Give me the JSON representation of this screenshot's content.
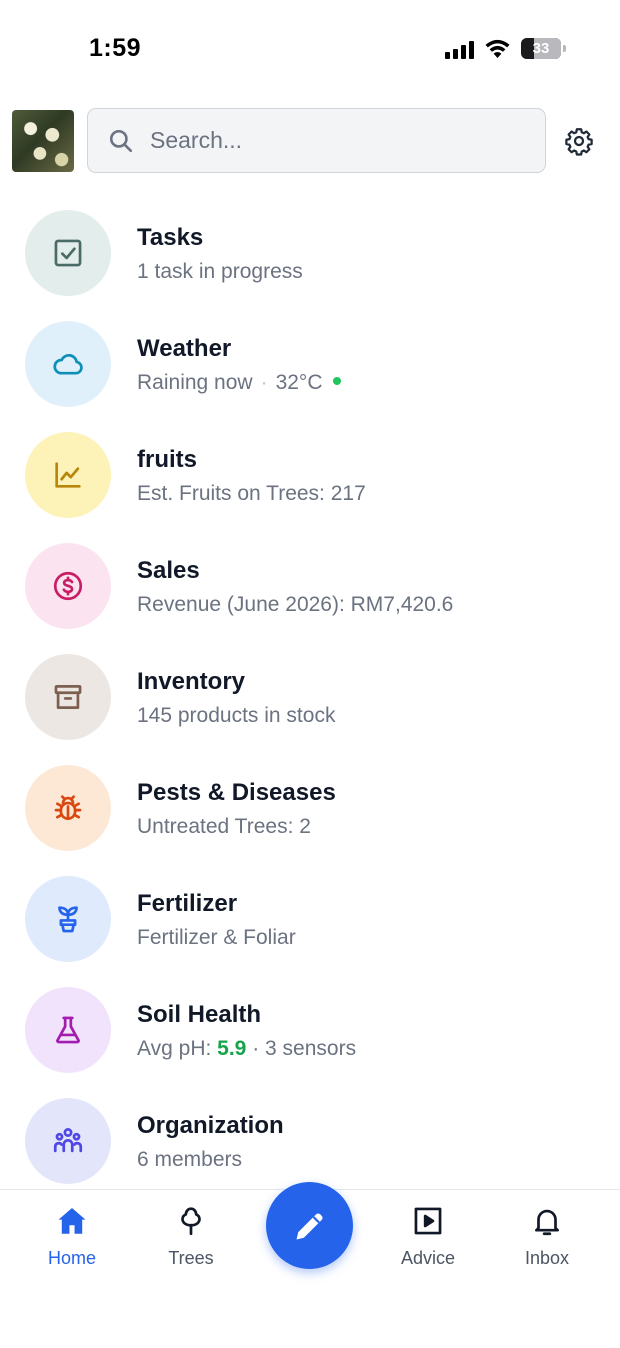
{
  "status_bar": {
    "time": "1:59",
    "battery": "33",
    "battery_level_percent": 33
  },
  "search": {
    "placeholder": "Search..."
  },
  "menu": [
    {
      "title": "Tasks",
      "subtitle": "1 task in progress",
      "icon": "checkbox-icon",
      "bg": "#e3edeb",
      "color": "#4b6b66"
    },
    {
      "title": "Weather",
      "subtitle": "Raining now",
      "separator": "·",
      "temperature": "32°C",
      "icon": "cloud-icon",
      "bg": "#dff0fb",
      "color": "#0e8fb8"
    },
    {
      "title": "fruits",
      "subtitle": "Est. Fruits on Trees: 217",
      "icon": "chart-line-icon",
      "bg": "#fdf3b8",
      "color": "#b7870c"
    },
    {
      "title": "Sales",
      "subtitle": "Revenue (June 2026): RM7,420.6",
      "icon": "dollar-circle-icon",
      "bg": "#fbe3ef",
      "color": "#c81e66"
    },
    {
      "title": "Inventory",
      "subtitle": "145 products in stock",
      "icon": "archive-box-icon",
      "bg": "#ece7e3",
      "color": "#7c5f50"
    },
    {
      "title": "Pests & Diseases",
      "subtitle": "Untreated Trees: 2",
      "icon": "bug-icon",
      "bg": "#fde8d5",
      "color": "#d9480f"
    },
    {
      "title": "Fertilizer",
      "subtitle": "Fertilizer & Foliar",
      "icon": "plant-pot-icon",
      "bg": "#dfeafc",
      "color": "#2563eb"
    },
    {
      "title": "Soil Health",
      "subtitle_prefix": "Avg pH: ",
      "ph": "5.9",
      "subtitle_suffix": " · 3 sensors",
      "icon": "flask-icon",
      "bg": "#f1e3fb",
      "color": "#a21caf"
    },
    {
      "title": "Organization",
      "subtitle": "6 members",
      "icon": "people-group-icon",
      "bg": "#e3e6fb",
      "color": "#4f46e5"
    }
  ],
  "bottom_nav": {
    "home": "Home",
    "trees": "Trees",
    "advice": "Advice",
    "inbox": "Inbox"
  },
  "colors": {
    "accent": "#2563eb",
    "green": "#16a34a"
  }
}
